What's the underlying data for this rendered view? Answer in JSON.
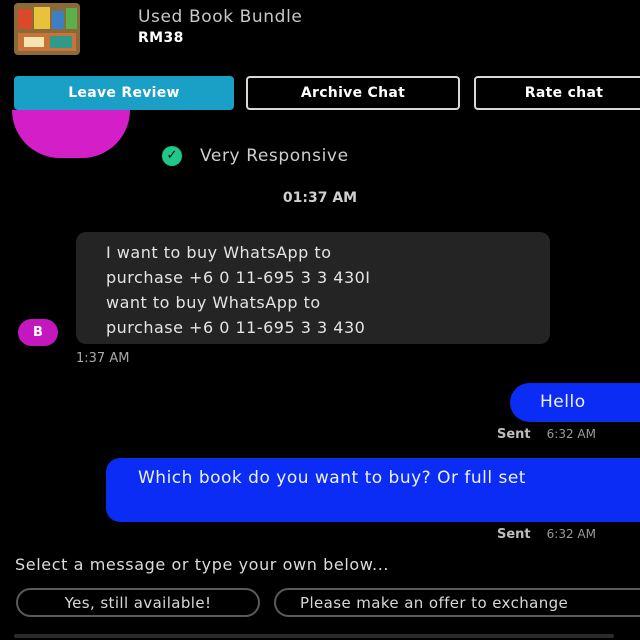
{
  "listing": {
    "title": "Used Book Bundle",
    "price": "RM38"
  },
  "actions": {
    "leave_review": "Leave Review",
    "archive_chat": "Archive Chat",
    "rate_chat": "Rate chat"
  },
  "seller": {
    "responsiveness": "Very Responsive",
    "avatar_initial": "B"
  },
  "chat": {
    "date_separator": "01:37 AM",
    "messages": [
      {
        "direction": "incoming",
        "lines": [
          "I want to buy WhatsApp to",
          "purchase  +6 0 11-695  3 3 430I",
          "want to buy WhatsApp to",
          "purchase  +6 0 11-695  3 3 430"
        ],
        "time": "1:37 AM"
      },
      {
        "direction": "outgoing",
        "text": "Hello",
        "status": "Sent",
        "time": "6:32 AM"
      },
      {
        "direction": "outgoing",
        "text": "Which book do you want to buy? Or full set",
        "status": "Sent",
        "time": "6:32 AM"
      }
    ]
  },
  "quick_replies": {
    "prompt": "Select a message or type your own below...",
    "options": [
      "Yes, still available!",
      "Please make an offer to exchange"
    ]
  },
  "colors": {
    "background": "#000000",
    "accent_button": "#1aa0c6",
    "outgoing_bubble": "#0a2cf5",
    "incoming_bubble": "#242424",
    "avatar": "#c417c0",
    "responsive_badge": "#1fc78a"
  }
}
